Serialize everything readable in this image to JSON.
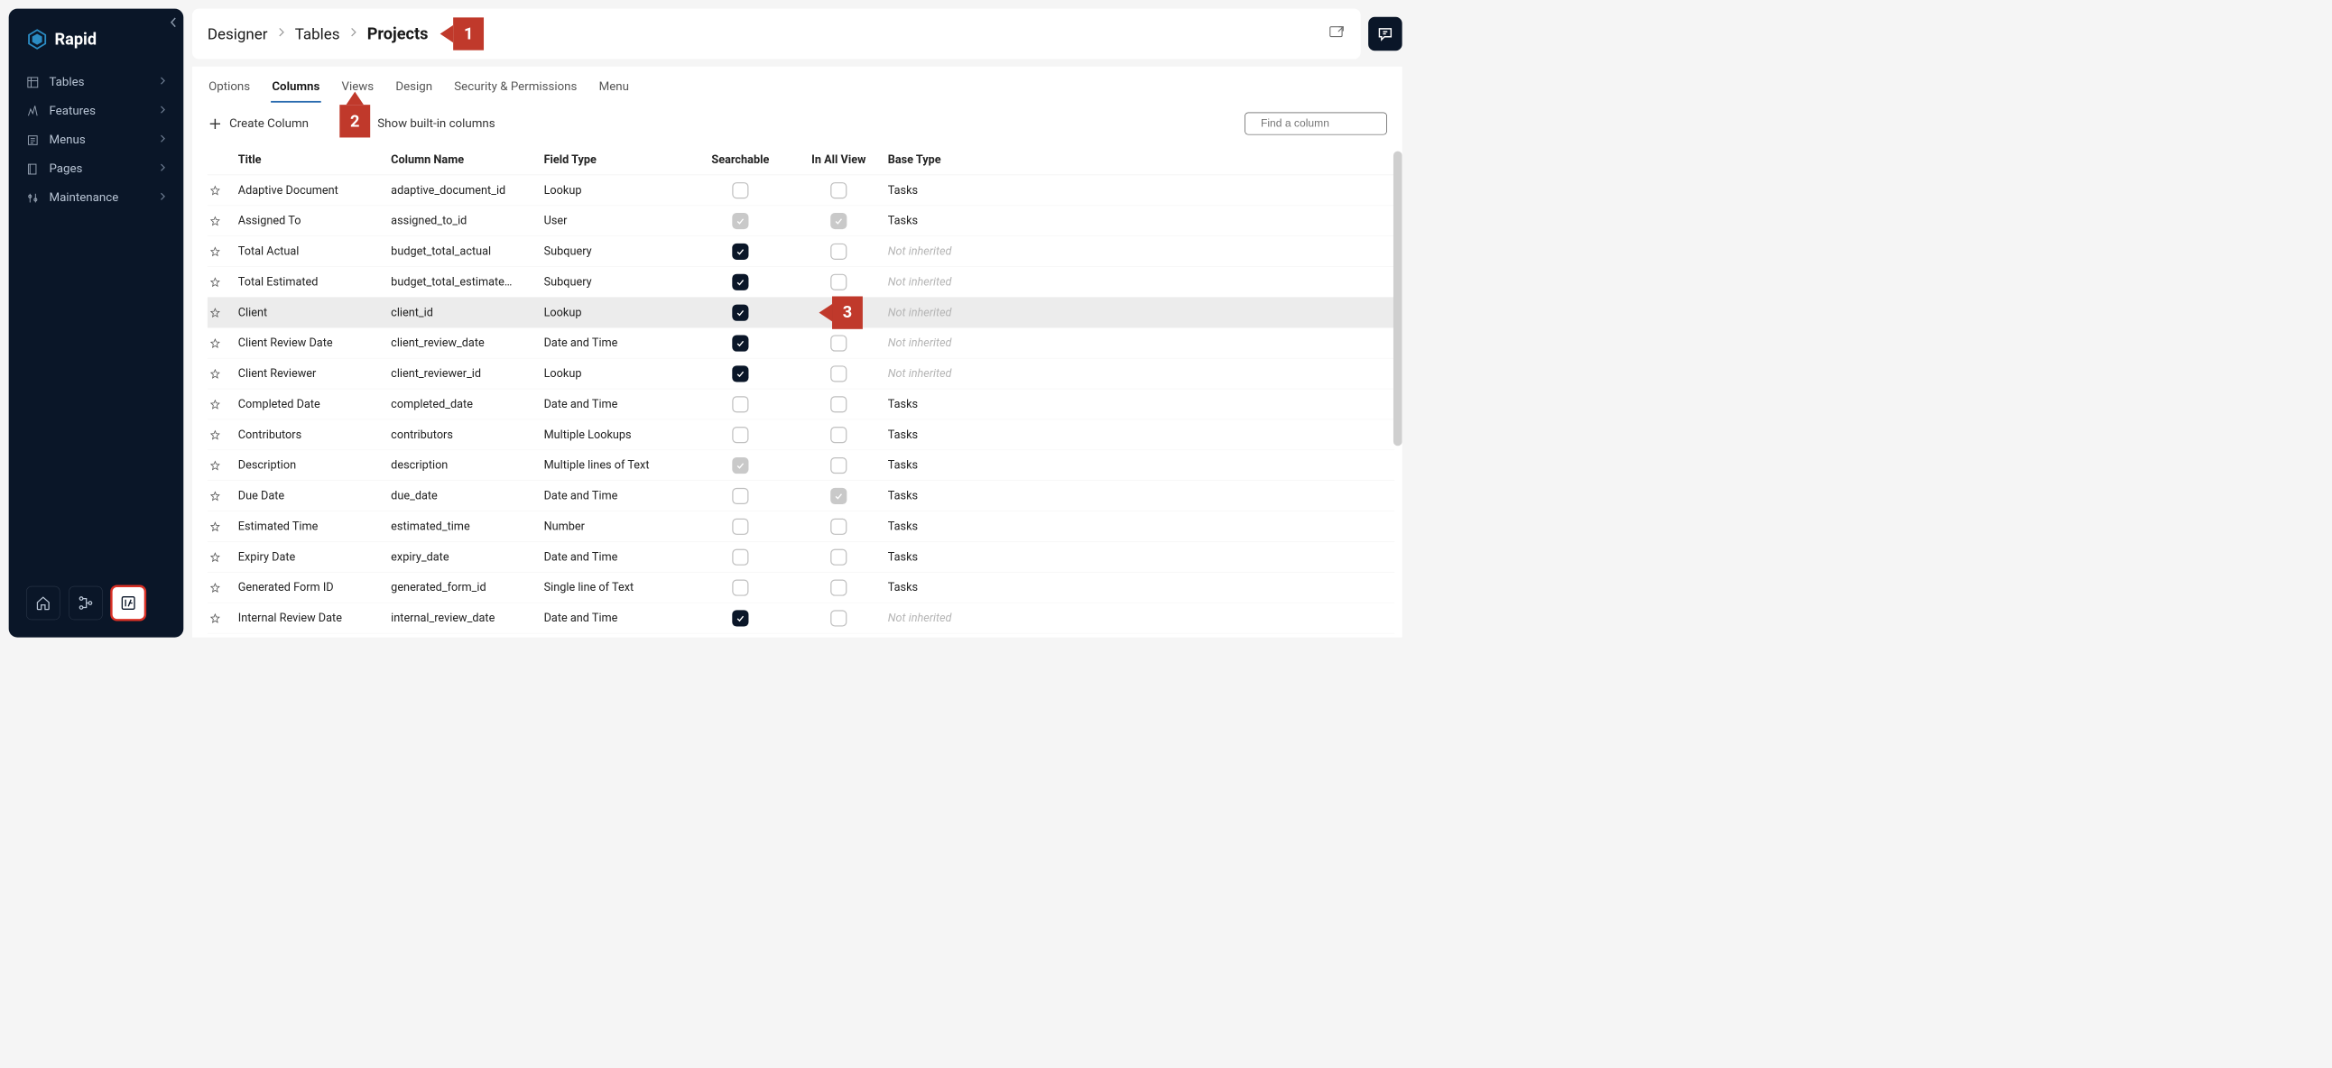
{
  "logo_text": "Rapid",
  "sidebar": {
    "items": [
      {
        "label": "Tables"
      },
      {
        "label": "Features"
      },
      {
        "label": "Menus"
      },
      {
        "label": "Pages"
      },
      {
        "label": "Maintenance"
      }
    ]
  },
  "breadcrumb": {
    "root": "Designer",
    "second": "Tables",
    "current": "Projects"
  },
  "tabs": [
    "Options",
    "Columns",
    "Views",
    "Design",
    "Security & Permissions",
    "Menu"
  ],
  "active_tab_index": 1,
  "toolbar": {
    "create_label": "Create Column",
    "builtin_label": "Show built-in columns",
    "search_placeholder": "Find a column"
  },
  "columns_header": {
    "title": "Title",
    "column_name": "Column Name",
    "field_type": "Field Type",
    "searchable": "Searchable",
    "in_all_view": "In All View",
    "base_type": "Base Type"
  },
  "rows": [
    {
      "title": "Adaptive Document",
      "name": "adaptive_document_id",
      "type": "Lookup",
      "searchable": "empty",
      "allview": "empty",
      "base": "Tasks",
      "base_muted": false,
      "hl": false
    },
    {
      "title": "Assigned To",
      "name": "assigned_to_id",
      "type": "User",
      "searchable": "locked",
      "allview": "locked",
      "base": "Tasks",
      "base_muted": false,
      "hl": false
    },
    {
      "title": "Total Actual",
      "name": "budget_total_actual",
      "type": "Subquery",
      "searchable": "checked",
      "allview": "empty",
      "base": "Not inherited",
      "base_muted": true,
      "hl": false
    },
    {
      "title": "Total Estimated",
      "name": "budget_total_estimate…",
      "type": "Subquery",
      "searchable": "checked",
      "allview": "empty",
      "base": "Not inherited",
      "base_muted": true,
      "hl": false
    },
    {
      "title": "Client",
      "name": "client_id",
      "type": "Lookup",
      "searchable": "checked",
      "allview": "checked",
      "base": "Not inherited",
      "base_muted": true,
      "hl": true
    },
    {
      "title": "Client Review Date",
      "name": "client_review_date",
      "type": "Date and Time",
      "searchable": "checked",
      "allview": "empty",
      "base": "Not inherited",
      "base_muted": true,
      "hl": false
    },
    {
      "title": "Client Reviewer",
      "name": "client_reviewer_id",
      "type": "Lookup",
      "searchable": "checked",
      "allview": "empty",
      "base": "Not inherited",
      "base_muted": true,
      "hl": false
    },
    {
      "title": "Completed Date",
      "name": "completed_date",
      "type": "Date and Time",
      "searchable": "empty",
      "allview": "empty",
      "base": "Tasks",
      "base_muted": false,
      "hl": false
    },
    {
      "title": "Contributors",
      "name": "contributors",
      "type": "Multiple Lookups",
      "searchable": "empty",
      "allview": "empty",
      "base": "Tasks",
      "base_muted": false,
      "hl": false
    },
    {
      "title": "Description",
      "name": "description",
      "type": "Multiple lines of Text",
      "searchable": "locked",
      "allview": "empty",
      "base": "Tasks",
      "base_muted": false,
      "hl": false
    },
    {
      "title": "Due Date",
      "name": "due_date",
      "type": "Date and Time",
      "searchable": "empty",
      "allview": "locked",
      "base": "Tasks",
      "base_muted": false,
      "hl": false
    },
    {
      "title": "Estimated Time",
      "name": "estimated_time",
      "type": "Number",
      "searchable": "empty",
      "allview": "empty",
      "base": "Tasks",
      "base_muted": false,
      "hl": false
    },
    {
      "title": "Expiry Date",
      "name": "expiry_date",
      "type": "Date and Time",
      "searchable": "empty",
      "allview": "empty",
      "base": "Tasks",
      "base_muted": false,
      "hl": false
    },
    {
      "title": "Generated Form ID",
      "name": "generated_form_id",
      "type": "Single line of Text",
      "searchable": "empty",
      "allview": "empty",
      "base": "Tasks",
      "base_muted": false,
      "hl": false
    },
    {
      "title": "Internal Review Date",
      "name": "internal_review_date",
      "type": "Date and Time",
      "searchable": "checked",
      "allview": "empty",
      "base": "Not inherited",
      "base_muted": true,
      "hl": false
    }
  ],
  "callouts": {
    "c1": "1",
    "c2": "2",
    "c3": "3"
  }
}
